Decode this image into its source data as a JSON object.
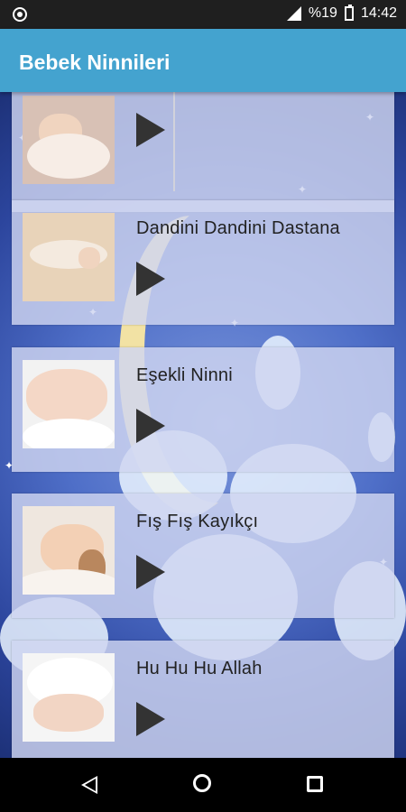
{
  "status_bar": {
    "battery_text": "%19",
    "time": "14:42"
  },
  "app_bar": {
    "title": "Bebek Ninnileri"
  },
  "songs": [
    {
      "title": ""
    },
    {
      "title": "Dandini Dandini Dastana"
    },
    {
      "title": "Eşekli Ninni"
    },
    {
      "title": "Fış Fış Kayıkçı"
    },
    {
      "title": "Hu Hu Hu Allah"
    }
  ],
  "icons": {
    "status_left": "circle-icon",
    "signal": "signal-icon",
    "battery": "battery-icon",
    "play": "play-icon",
    "back": "back-icon",
    "home": "home-icon",
    "recent": "recent-apps-icon"
  }
}
